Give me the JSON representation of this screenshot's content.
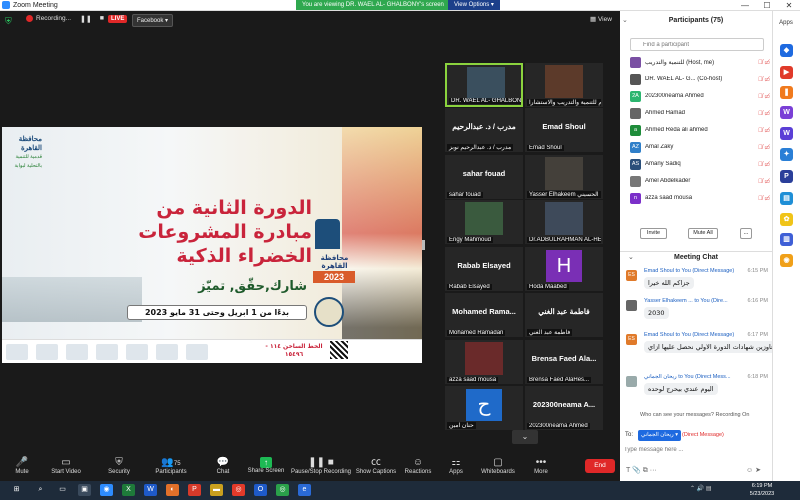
{
  "window": {
    "title": "Zoom Meeting",
    "controls": [
      "—",
      "☐",
      "✕"
    ]
  },
  "meeting_bar": {
    "recording": "Recording...",
    "live": "LIVE",
    "facebook": "Facebook ▾",
    "viewing_banner": "You are viewing DR. WAEL AL- GHALBONY's screen",
    "view_options": "View Options ▾",
    "view": "View"
  },
  "slide": {
    "logo_title": "محافظة القاهرة",
    "logo_sub": "قدمية للتنمية بالتحلية لبوابة",
    "headline1": "الدورة الثانية من",
    "headline2": "مبادرة المشروعات",
    "headline3": "الخضراء الذكية",
    "slogan": "شارك,حقّق, تميّز",
    "dates": "بدءًا من 1 ابريل وحتى 31 مايو 2023",
    "emblem_name": "محافظة القاهرة",
    "emblem_year": "2023",
    "hotline": "الخط الساخن ١١٤ - ١٥٤٩٦"
  },
  "gallery": [
    {
      "name": "DR. WAEL AL- GHALBONY",
      "center": "",
      "active": true
    },
    {
      "name": "مركز دعم للتنمية والتدريب والاستشارا",
      "center": "",
      "active": false
    },
    {
      "name": "مدرب / د. عبدالرحيم نوبز",
      "center": "مدرب / د. عبدالرحيم",
      "active": false
    },
    {
      "name": "Emad Shoul",
      "center": "Emad Shoul",
      "active": false
    },
    {
      "name": "sahar fouad",
      "center": "sahar fouad",
      "active": false
    },
    {
      "name": "Yasser Elhakeem الحسيني",
      "center": "",
      "active": false
    },
    {
      "name": "Engy Mahmoud",
      "center": "",
      "active": false
    },
    {
      "name": "Dr.ADBULRAHMAN AL-HEMMADI",
      "center": "",
      "active": false
    },
    {
      "name": "Rabab Elsayed",
      "center": "Rabab Elsayed",
      "active": false
    },
    {
      "name": "Hoda Maabed",
      "center": "",
      "letter": "H",
      "active": false
    },
    {
      "name": "Mohamed Ramadan",
      "center": "Mohamed Rama...",
      "active": false
    },
    {
      "name": "فاطمة عبد الغني",
      "center": "فاطمة عبد الغني",
      "active": false
    },
    {
      "name": "azza saad mousa",
      "center": "",
      "active": false
    },
    {
      "name": "Brensa Faed AlaHes...",
      "center": "Brensa Faed Ala...",
      "active": false
    },
    {
      "name": "حنان امين",
      "center": "",
      "letter": "ح",
      "active": false
    },
    {
      "name": "202300neama Ahmed",
      "center": "202300neama A...",
      "active": false
    }
  ],
  "toolbar": {
    "mute": "Mute",
    "start_video": "Start Video",
    "security": "Security",
    "participants": "Participants",
    "participants_count": "75",
    "chat": "Chat",
    "share_screen": "Share Screen",
    "pause_recording": "Pause/Stop Recording",
    "show_captions": "Show Captions",
    "reactions": "Reactions",
    "apps": "Apps",
    "whiteboards": "Whiteboards",
    "more": "More",
    "end": "End"
  },
  "participants_panel": {
    "title": "Participants (75)",
    "search_placeholder": "Find a participant",
    "rows": [
      {
        "name": "للتنمية والتدريب (Host, me)",
        "initials": "",
        "color": "#7a4fa3"
      },
      {
        "name": "DR. WAEL AL- G... (Co-host)",
        "initials": "",
        "color": "#555555"
      },
      {
        "name": "202300neama Ahmed",
        "initials": "2A",
        "color": "#2bb56f"
      },
      {
        "name": "Ahmed Hamad",
        "initials": "",
        "color": "#666666"
      },
      {
        "name": "Ahmed Reda ali ahmed",
        "initials": "a",
        "color": "#1e8c3a"
      },
      {
        "name": "Amal Zaky",
        "initials": "AZ",
        "color": "#2f7fc9"
      },
      {
        "name": "Amany Sadiq",
        "initials": "AS",
        "color": "#2a4f7a"
      },
      {
        "name": "Amel Abdelkader",
        "initials": "",
        "color": "#777777"
      },
      {
        "name": "azza saad mousa",
        "initials": "n",
        "color": "#7b2fc9"
      }
    ],
    "invite": "Invite",
    "mute_all": "Mute All",
    "more": "..."
  },
  "chat": {
    "title": "Meeting Chat",
    "messages": [
      {
        "from": "Emad Shoul to You (Direct Message)",
        "time": "6:15 PM",
        "text": "جزاكم الله خيرا",
        "initials": "ES",
        "color": "#e07a2a"
      },
      {
        "from": "Yasser Elhakeem ... to You (Dire...",
        "time": "6:16 PM",
        "text": "2030",
        "initials": "",
        "color": "#666666"
      },
      {
        "from": "Emad Shoul to You (Direct Message)",
        "time": "6:17 PM",
        "text": "عاوزين شهادات الدورة الاولي نحصل عليها ازاي",
        "initials": "ES",
        "color": "#e07a2a"
      },
      {
        "from": "ريحان الجماني to You (Direct Mess...",
        "time": "6:18 PM",
        "text": "اليوم عندي بيحرج لوحده",
        "initials": "",
        "color": "#9aa"
      }
    ],
    "notice": "Who can see your messages? Recording On",
    "to_label": "To:",
    "to_value": "ريحان الجماني ▾",
    "to_dm": "(Direct Message)",
    "input_placeholder": "Type message here ..."
  },
  "apps_rail": {
    "label": "Apps"
  },
  "taskbar": {
    "time": "6:19 PM",
    "date": "5/23/2023"
  }
}
